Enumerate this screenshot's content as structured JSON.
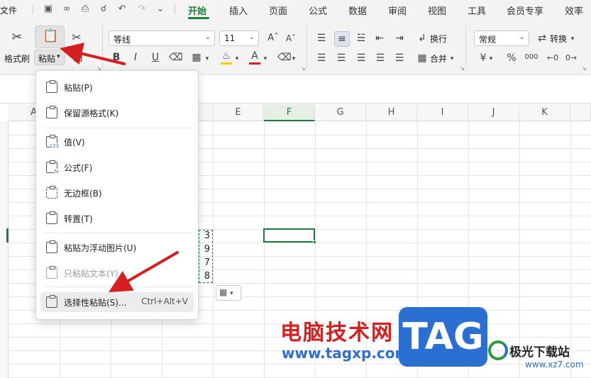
{
  "menubar": {
    "file": "文件",
    "tabs": [
      "开始",
      "插入",
      "页面",
      "公式",
      "数据",
      "审阅",
      "视图",
      "工具",
      "会员专享",
      "效率"
    ],
    "active_tab": "开始"
  },
  "ribbon": {
    "format_painter": "格式刷",
    "paste": "粘贴",
    "font_name": "等线",
    "font_size": "11",
    "wrap": "换行",
    "merge": "合并",
    "number_format": "常规",
    "convert": "转换",
    "currency": "¥",
    "percent": "%",
    "thousands": "000",
    "bold": "B",
    "italic": "I",
    "underline": "U",
    "font_color_letter": "A",
    "highlight_color": "#f5d300",
    "font_color": "#e02020"
  },
  "columns": [
    "A",
    "E",
    "F",
    "G",
    "H",
    "I",
    "J",
    "K"
  ],
  "selected_column": "F",
  "cells": [
    "3",
    "9",
    "7",
    "8"
  ],
  "paste_menu": {
    "items": [
      {
        "label": "粘贴(P)",
        "icon": "paste-icon"
      },
      {
        "label": "保留源格式(K)",
        "icon": "paste-keep-format-icon"
      },
      {
        "label": "值(V)",
        "icon": "paste-values-icon",
        "sub": "123"
      },
      {
        "label": "公式(F)",
        "icon": "paste-formula-icon",
        "sub": "fx"
      },
      {
        "label": "无边框(B)",
        "icon": "paste-no-border-icon"
      },
      {
        "label": "转置(T)",
        "icon": "paste-transpose-icon"
      },
      {
        "label": "粘贴为浮动图片(U)",
        "icon": "paste-picture-icon"
      },
      {
        "label": "只粘贴文本(Y)",
        "icon": "paste-text-icon",
        "disabled": true
      },
      {
        "label": "选择性粘贴(S)...",
        "icon": "paste-special-icon",
        "shortcut": "Ctrl+Alt+V"
      }
    ]
  },
  "watermark": {
    "cn": "电脑技术网",
    "url": "www.tagxp.com",
    "tag": "TAG",
    "site2": "极光下载站",
    "url2": "www.xz7.com"
  },
  "colors": {
    "accent": "#1a7f3a",
    "arrow": "#d62020",
    "brand_blue": "#2a6fd1"
  }
}
